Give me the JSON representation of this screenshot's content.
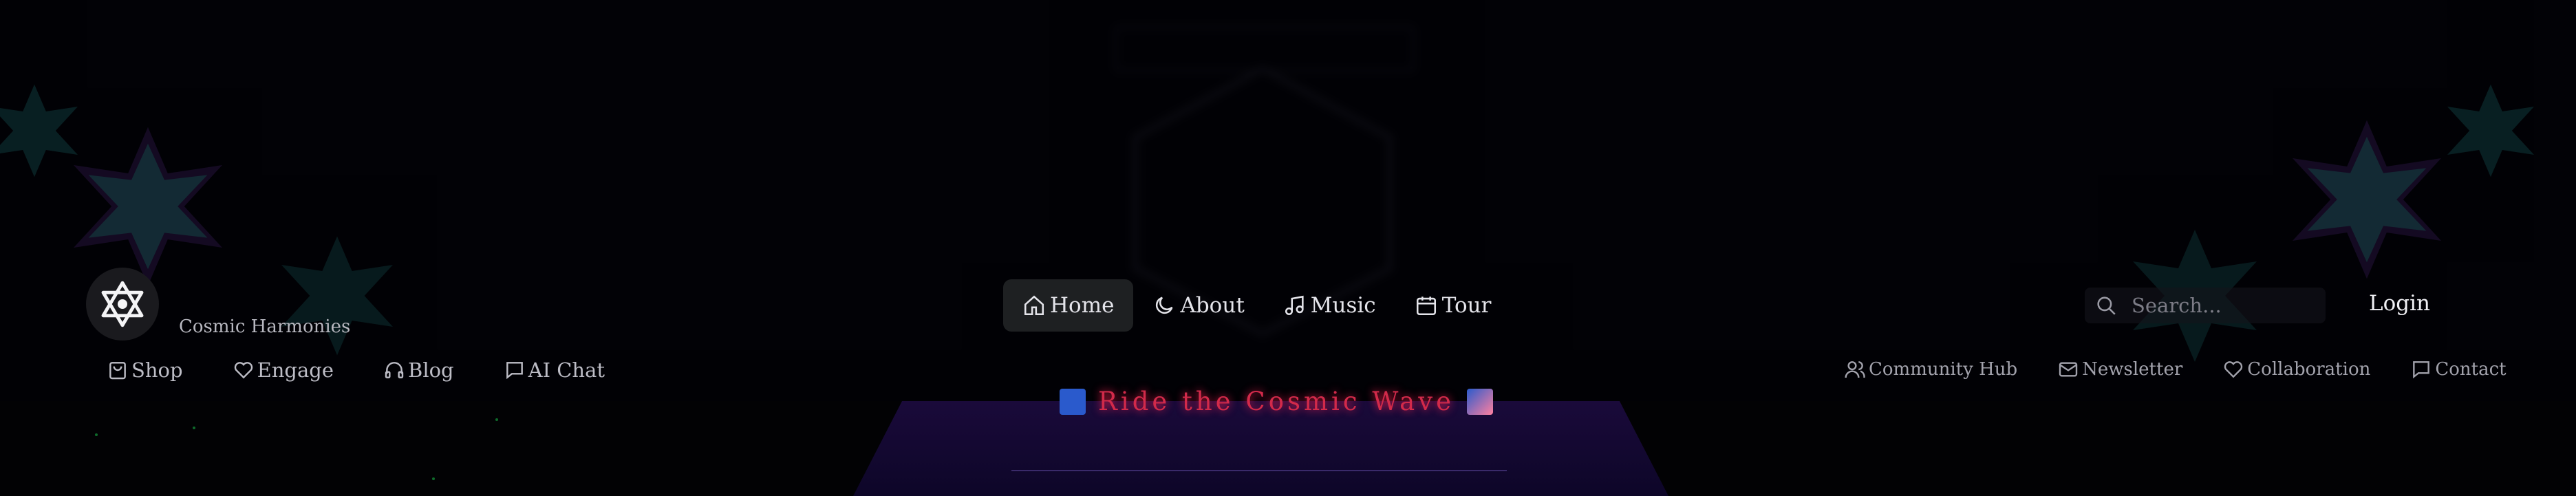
{
  "brand": {
    "subtitle": "Cosmic Harmonies",
    "logo_icon": "hexagram-icon"
  },
  "nav": {
    "items": [
      {
        "label": "Home",
        "icon": "home-icon",
        "active": true
      },
      {
        "label": "About",
        "icon": "moon-icon",
        "active": false
      },
      {
        "label": "Music",
        "icon": "music-note-icon",
        "active": false
      },
      {
        "label": "Tour",
        "icon": "calendar-icon",
        "active": false
      }
    ]
  },
  "search": {
    "placeholder": "Search..."
  },
  "login_label": "Login",
  "subnav_left": [
    {
      "label": "Shop",
      "icon": "shopping-bag-icon"
    },
    {
      "label": "Engage",
      "icon": "heart-icon"
    },
    {
      "label": "Blog",
      "icon": "headphones-icon"
    },
    {
      "label": "AI Chat",
      "icon": "chat-icon"
    }
  ],
  "subnav_right": [
    {
      "label": "Community Hub",
      "icon": "users-icon"
    },
    {
      "label": "Newsletter",
      "icon": "mail-icon"
    },
    {
      "label": "Collaboration",
      "icon": "heart-icon"
    },
    {
      "label": "Contact",
      "icon": "chat-icon"
    }
  ],
  "hero": {
    "banner_text": "Ride the Cosmic Wave"
  },
  "colors": {
    "accent_teal": "#2aa7a0",
    "star_purple": "#6a3aa8",
    "banner_red": "#d22a4a",
    "stage_purple": "#1a0a3a"
  }
}
